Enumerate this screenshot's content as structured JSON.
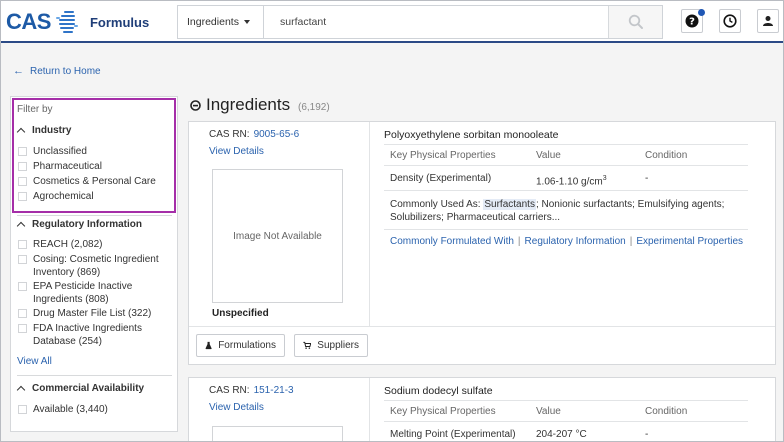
{
  "header": {
    "brand": "CAS",
    "product": "Formulus",
    "search": {
      "category": "Ingredients",
      "query": "surfactant"
    },
    "colors": {
      "brand_blue": "#1d5aa6",
      "accent_border": "#2b4a86",
      "notification": "#1f57b5"
    }
  },
  "nav": {
    "return_label": "Return to Home"
  },
  "sidebar": {
    "filter_by": "Filter by",
    "groups": [
      {
        "title": "Industry",
        "options": [
          "Unclassified",
          "Pharmaceutical",
          "Cosmetics & Personal Care",
          "Agrochemical"
        ]
      },
      {
        "title": "Regulatory Information",
        "options": [
          "REACH (2,082)",
          "Cosing: Cosmetic Ingredient Inventory (869)",
          "EPA Pesticide Inactive Ingredients (808)",
          "Drug Master File List (322)",
          "FDA Inactive Ingredients Database (254)"
        ]
      },
      {
        "title": "Commercial Availability",
        "options": [
          "Available (3,440)"
        ]
      }
    ],
    "view_all": "View All",
    "highlight_color": "#a52ea8"
  },
  "results": {
    "title": "Ingredients",
    "count": "(6,192)",
    "cards": [
      {
        "cas_label": "CAS RN:",
        "cas_rn": "9005-65-6",
        "view_details": "View Details",
        "image_text": "Image Not Available",
        "stereo": "Unspecified",
        "name": "Polyoxyethylene sorbitan monooleate",
        "prop_headers": [
          "Key Physical Properties",
          "Value",
          "Condition"
        ],
        "properties": [
          {
            "name": "Density (Experimental)",
            "value": "1.06-1.10 g/cm",
            "value_sup": "3",
            "condition": "-"
          }
        ],
        "used_as_label": "Commonly Used As:",
        "used_as_highlight": "Surfactants",
        "used_as_rest": "; Nonionic surfactants; Emulsifying agents; Solubilizers; Pharmaceutical carriers...",
        "links": [
          "Commonly Formulated With",
          "Regulatory Information",
          "Experimental Properties"
        ],
        "buttons": {
          "formulations": "Formulations",
          "suppliers": "Suppliers"
        }
      },
      {
        "cas_label": "CAS RN:",
        "cas_rn": "151-21-3",
        "view_details": "View Details",
        "name": "Sodium dodecyl sulfate",
        "prop_headers": [
          "Key Physical Properties",
          "Value",
          "Condition"
        ],
        "properties": [
          {
            "name": "Melting Point (Experimental)",
            "value": "204-207 °C",
            "condition": "-"
          }
        ]
      }
    ]
  }
}
